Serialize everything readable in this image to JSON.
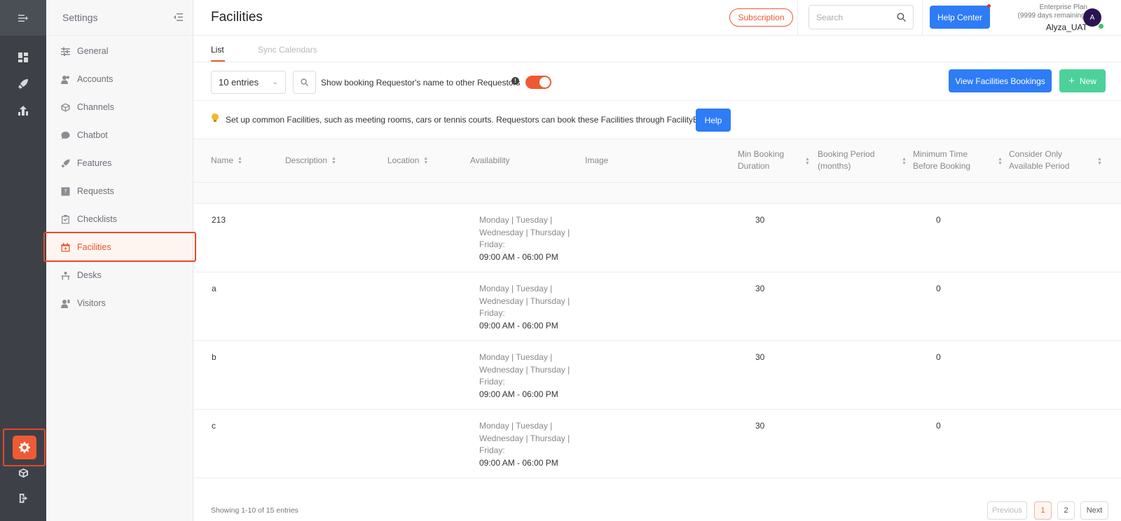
{
  "rail": {
    "icons": [
      "menu-icon",
      "dashboard-icon",
      "rocket-icon",
      "analytics-icon",
      "gear-icon",
      "box-icon",
      "logout-icon"
    ]
  },
  "sidebar": {
    "title": "Settings",
    "items": [
      {
        "label": "General",
        "icon": "sliders-icon"
      },
      {
        "label": "Accounts",
        "icon": "users-icon"
      },
      {
        "label": "Channels",
        "icon": "cube-icon"
      },
      {
        "label": "Chatbot",
        "icon": "chat-icon"
      },
      {
        "label": "Features",
        "icon": "rocket-icon"
      },
      {
        "label": "Requests",
        "icon": "question-icon"
      },
      {
        "label": "Checklists",
        "icon": "checklist-icon"
      },
      {
        "label": "Facilities",
        "icon": "calendar-plus-icon"
      },
      {
        "label": "Desks",
        "icon": "desk-icon"
      },
      {
        "label": "Visitors",
        "icon": "visitor-icon"
      }
    ]
  },
  "header": {
    "title": "Facilities",
    "subscription": "Subscription",
    "search_placeholder": "Search",
    "help_center": "Help Center",
    "plan_line1": "Enterprise Plan",
    "plan_line2": "(9999 days remaining)",
    "username": "Alyza_UAT",
    "avatar_letter": "A"
  },
  "tabs": [
    "List",
    "Sync Calendars"
  ],
  "toolbar": {
    "entries": "10 entries",
    "show_label": "Show booking Requestor's name to other Requestors",
    "view_bookings": "View Facilities Bookings",
    "new": "New"
  },
  "tip": {
    "text": "Set up common Facilities, such as meeting rooms, cars or tennis courts. Requestors can book these Facilities through FacilityBot.",
    "help": "Help"
  },
  "table": {
    "headers": {
      "name": "Name",
      "description": "Description",
      "location": "Location",
      "availability": "Availability",
      "image": "Image",
      "min_booking_1": "Min Booking",
      "min_booking_2": "Duration",
      "booking_period_1": "Booking Period",
      "booking_period_2": "(months)",
      "min_time_1": "Minimum Time",
      "min_time_2": "Before Booking",
      "consider_1": "Consider Only",
      "consider_2": "Available Period"
    },
    "rows": [
      {
        "name": "213",
        "avail_days": [
          "Monday | Tuesday |",
          "Wednesday | Thursday |",
          "Friday:"
        ],
        "avail_time": "09:00 AM - 06:00 PM",
        "min_duration": "30",
        "min_time": "0"
      },
      {
        "name": "a",
        "avail_days": [
          "Monday | Tuesday |",
          "Wednesday | Thursday |",
          "Friday:"
        ],
        "avail_time": "09:00 AM - 06:00 PM",
        "min_duration": "30",
        "min_time": "0"
      },
      {
        "name": "b",
        "avail_days": [
          "Monday | Tuesday |",
          "Wednesday | Thursday |",
          "Friday:"
        ],
        "avail_time": "09:00 AM - 06:00 PM",
        "min_duration": "30",
        "min_time": "0"
      },
      {
        "name": "c",
        "avail_days": [
          "Monday | Tuesday |",
          "Wednesday | Thursday |",
          "Friday:"
        ],
        "avail_time": "09:00 AM - 06:00 PM",
        "min_duration": "30",
        "min_time": "0"
      }
    ]
  },
  "footer": {
    "showing": "Showing 1-10 of 15 entries",
    "previous": "Previous",
    "page1": "1",
    "page2": "2",
    "next": "Next"
  },
  "colors": {
    "accent": "#ee5a33",
    "primary": "#2e7cf6",
    "success": "#4cd19a",
    "rail": "#3d4147"
  }
}
